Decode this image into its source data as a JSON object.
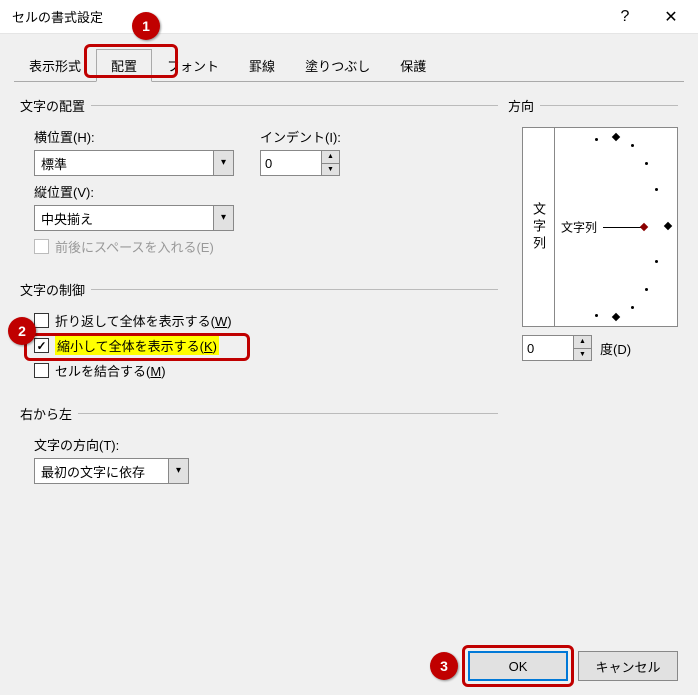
{
  "title": "セルの書式設定",
  "tabs": [
    "表示形式",
    "配置",
    "フォント",
    "罫線",
    "塗りつぶし",
    "保護"
  ],
  "active_tab_index": 1,
  "group_text_align": "文字の配置",
  "horizontal_label": "横位置(H):",
  "horizontal_value": "標準",
  "indent_label": "インデント(I):",
  "indent_value": "0",
  "vertical_label": "縦位置(V):",
  "vertical_value": "中央揃え",
  "justify_label": "前後にスペースを入れる(E)",
  "group_text_control": "文字の制御",
  "wrap_label": "折り返して全体を表示する(W)",
  "shrink_label": "縮小して全体を表示する(K)",
  "merge_label": "セルを結合する(M)",
  "group_rtl": "右から左",
  "textdir_label": "文字の方向(T):",
  "textdir_value": "最初の文字に依存",
  "group_orientation": "方向",
  "orient_vertical_text": "文字列",
  "orient_dial_text": "文字列",
  "orient_value": "0",
  "orient_unit": "度(D)",
  "ok": "OK",
  "cancel": "キャンセル",
  "badges": {
    "b1": "1",
    "b2": "2",
    "b3": "3"
  }
}
